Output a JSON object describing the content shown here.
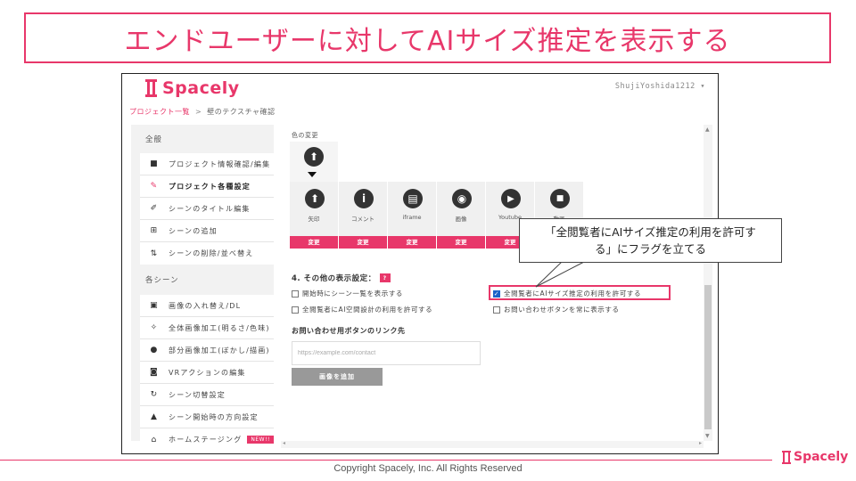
{
  "slide": {
    "title": "エンドユーザーに対してAIサイズ推定を表示する",
    "copyright": "Copyright Spacely, Inc. All Rights Reserved",
    "footer_logo": "Spacely",
    "accent_color": "#e8376a"
  },
  "app": {
    "logo_text": "Spacely",
    "user_menu": "ShujiYoshida1212 ▾",
    "breadcrumb": {
      "link": "プロジェクト一覧",
      "separator": ">",
      "current": "壁のテクスチャ確認"
    }
  },
  "sidebar": {
    "section_general": "全般",
    "general_items": [
      {
        "icon": "file-icon",
        "glyph": "■",
        "label": "プロジェクト情報確認/編集"
      },
      {
        "icon": "wrench-icon",
        "glyph": "✎",
        "label": "プロジェクト各種設定"
      },
      {
        "icon": "pencil-icon",
        "glyph": "✐",
        "label": "シーンのタイトル編集"
      },
      {
        "icon": "plus-square-icon",
        "glyph": "⊞",
        "label": "シーンの追加"
      },
      {
        "icon": "sort-icon",
        "glyph": "⇅",
        "label": "シーンの削除/並べ替え"
      }
    ],
    "section_scenes": "各シーン",
    "scene_items": [
      {
        "icon": "image-swap-icon",
        "glyph": "▣",
        "label": "画像の入れ替え/DL"
      },
      {
        "icon": "magic-icon",
        "glyph": "✧",
        "label": "全体画像加工(明るさ/色味)"
      },
      {
        "icon": "palette-icon",
        "glyph": "●",
        "label": "部分画像加工(ぼかし/描画)"
      },
      {
        "icon": "vr-icon",
        "glyph": "◙",
        "label": "VRアクションの編集"
      },
      {
        "icon": "refresh-icon",
        "glyph": "↻",
        "label": "シーン切替設定"
      },
      {
        "icon": "triangle-up-icon",
        "glyph": "▲",
        "label": "シーン開始時の方向設定"
      },
      {
        "icon": "home-icon",
        "glyph": "⌂",
        "label": "ホームステージング",
        "badge": "NEW!!"
      }
    ]
  },
  "main": {
    "color_change_label": "色の変更",
    "icon_tiles": [
      {
        "icon": "arrow-up-circle-icon",
        "glyph": "⬆",
        "label": "矢印",
        "button": "変更"
      },
      {
        "icon": "info-circle-icon",
        "glyph": "i",
        "label": "コメント",
        "button": "変更"
      },
      {
        "icon": "iframe-icon",
        "glyph": "▤",
        "label": "iframe",
        "button": "変更"
      },
      {
        "icon": "camera-icon",
        "glyph": "◉",
        "label": "画像",
        "button": "変更"
      },
      {
        "icon": "youtube-icon",
        "glyph": "▶",
        "label": "Youtube",
        "button": "変更"
      },
      {
        "icon": "video-icon",
        "glyph": "■",
        "label": "動画",
        "button": "変更"
      }
    ],
    "other_settings_heading": "4. その他の表示設定：",
    "help_badge": "?",
    "checkboxes": [
      {
        "label": "開始時にシーン一覧を表示する",
        "checked": false
      },
      {
        "label": "全閲覧者にAIサイズ推定の利用を許可する",
        "checked": true
      },
      {
        "label": "全閲覧者にAI空間設計の利用を許可する",
        "checked": false
      },
      {
        "label": "お問い合わせボタンを常に表示する",
        "checked": false
      }
    ],
    "contact_link_heading": "お問い合わせ用ボタンのリンク先",
    "contact_link_placeholder": "https://example.com/contact",
    "add_image_button": "画像を追加"
  },
  "callout": {
    "line1": "「全閲覧者にAIサイズ推定の利用を許可す",
    "line2": "る」にフラグを立てる"
  }
}
